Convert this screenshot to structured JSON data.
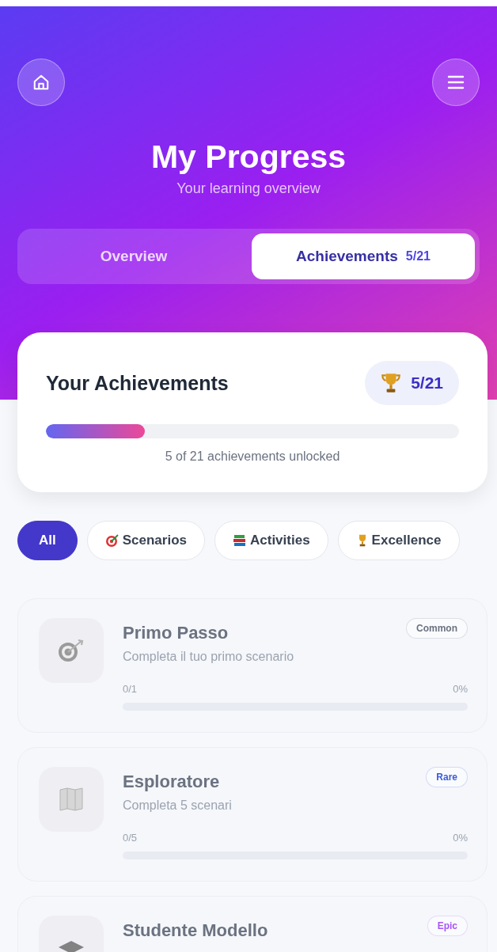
{
  "header": {
    "title": "My Progress",
    "subtitle": "Your learning overview"
  },
  "tabs": [
    {
      "label": "Overview",
      "selected": false
    },
    {
      "label": "Achievements",
      "count": "5/21",
      "selected": true
    }
  ],
  "summary": {
    "title": "Your Achievements",
    "badge": "5/21",
    "level": 0.24,
    "caption": "5 of 21 achievements unlocked"
  },
  "filters": [
    {
      "label": "All",
      "kind": "none",
      "selected": true
    },
    {
      "label": "Scenarios",
      "kind": "target",
      "selected": false
    },
    {
      "label": "Activities",
      "kind": "books",
      "selected": false
    },
    {
      "label": "Excellence",
      "kind": "trophy",
      "selected": false
    }
  ],
  "achievements": [
    {
      "title": "Primo Passo",
      "description": "Completa il tuo primo scenario",
      "rarity": "Common",
      "color": "#6b7280",
      "kind": "target",
      "locked": true,
      "progress": "0/1",
      "percent": "0%",
      "level": 0
    },
    {
      "title": "Esploratore",
      "description": "Completa 5 scenari",
      "rarity": "Rare",
      "color": "#3b5bdb",
      "kind": "map",
      "locked": true,
      "progress": "0/5",
      "percent": "0%",
      "level": 0
    },
    {
      "title": "Studente Modello",
      "rarity": "Epic",
      "color": "#a855f7",
      "kind": "cap",
      "locked": true
    }
  ]
}
